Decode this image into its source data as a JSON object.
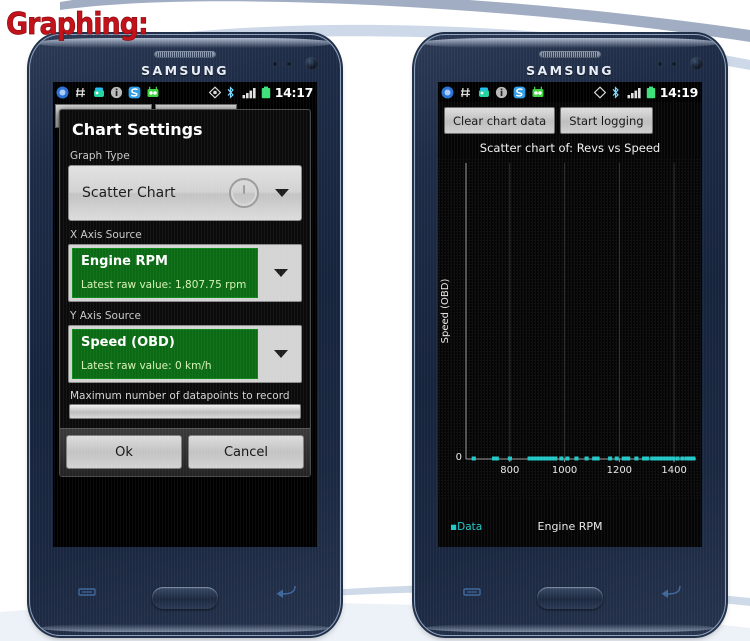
{
  "page": {
    "heading": "Graphing:"
  },
  "phones": {
    "left": {
      "brand": "SAMSUNG",
      "status_bar": {
        "time": "14:17",
        "icons": [
          "app-circle-icon",
          "hash-icon",
          "android-robot-icon",
          "info-icon",
          "s-app-icon",
          "green-robot-icon",
          "gps-icon",
          "bluetooth-icon",
          "signal-bars-icon",
          "battery-icon"
        ]
      },
      "background_buttons": [
        {
          "label": ""
        },
        {
          "label": ""
        }
      ],
      "dialog": {
        "title": "Chart Settings",
        "graph_type": {
          "label": "Graph Type",
          "value": "Scatter Chart"
        },
        "x_axis": {
          "label": "X Axis Source",
          "name": "Engine RPM",
          "latest": "Latest raw value: 1,807.75 rpm"
        },
        "y_axis": {
          "label": "Y Axis Source",
          "name": "Speed (OBD)",
          "latest": "Latest raw value: 0 km/h"
        },
        "max_datapoints": {
          "label": "Maximum number of datapoints to record",
          "value": "",
          "placeholder": ""
        },
        "buttons": {
          "ok": "Ok",
          "cancel": "Cancel"
        }
      }
    },
    "right": {
      "brand": "SAMSUNG",
      "status_bar": {
        "time": "14:19",
        "icons": [
          "app-circle-icon",
          "hash-icon",
          "android-robot-icon",
          "info-icon",
          "s-app-icon",
          "green-robot-icon",
          "gps-icon",
          "bluetooth-icon",
          "signal-bars-icon",
          "battery-icon"
        ]
      },
      "toolbar": {
        "clear": "Clear chart data",
        "start": "Start logging"
      },
      "legend": "Data"
    }
  },
  "colors": {
    "accent_green": "#0a6b14",
    "value_text": "#d7f2b4",
    "data_cyan": "#22c7c7",
    "heading_red": "#c2121a",
    "chassis": "#1d2b46"
  },
  "chart_data": {
    "type": "scatter",
    "title": "Scatter chart of: Revs vs Speed",
    "xlabel": "Engine RPM",
    "ylabel": "Speed (OBD)",
    "legend": [
      "Data"
    ],
    "legend_position": "bottom-left",
    "grid": true,
    "xlim": [
      640,
      1480
    ],
    "ylim": [
      0,
      1
    ],
    "xticks": [
      800,
      1000,
      1200,
      1400
    ],
    "yticks": [
      0
    ],
    "ytick_labels": [
      "0"
    ],
    "series": [
      {
        "name": "Data",
        "color": "#22c7c7",
        "x": [
          668,
          742,
          752,
          800,
          872,
          878,
          884,
          893,
          900,
          906,
          916,
          930,
          944,
          951,
          957,
          966,
          988,
          1010,
          1043,
          1080,
          1108,
          1120,
          1166,
          1190,
          1216,
          1221,
          1232,
          1262,
          1290,
          1301,
          1320,
          1331,
          1338,
          1346,
          1354,
          1362,
          1372,
          1385,
          1396,
          1412,
          1430,
          1446,
          1458,
          1470
        ],
        "y": [
          0,
          0,
          0,
          0,
          0,
          0,
          0,
          0,
          0,
          0,
          0,
          0,
          0,
          0,
          0,
          0,
          0,
          0,
          0,
          0,
          0,
          0,
          0,
          0,
          0,
          0,
          0,
          0,
          0,
          0,
          0,
          0,
          0,
          0,
          0,
          0,
          0,
          0,
          0,
          0,
          0,
          0,
          0,
          0
        ]
      }
    ]
  }
}
